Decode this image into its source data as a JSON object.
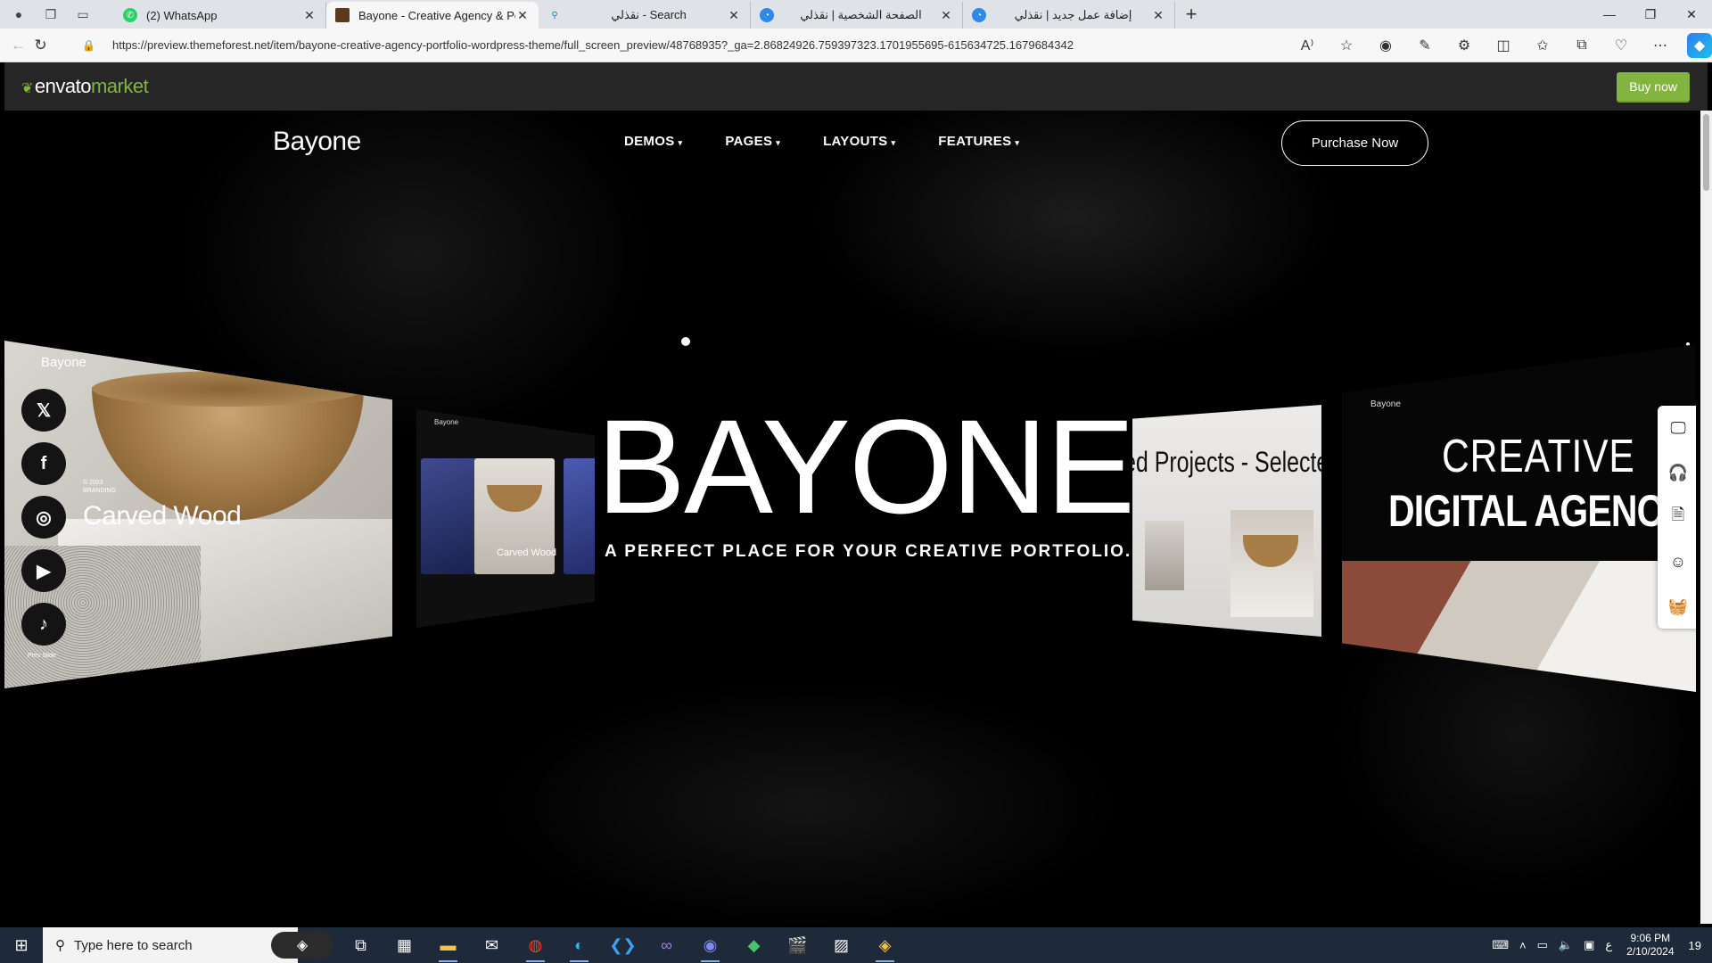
{
  "browser": {
    "tabs": [
      {
        "title": "(2) WhatsApp",
        "favicon": "whatsapp-icon",
        "rtl": false,
        "active": false
      },
      {
        "title": "Bayone - Creative Agency & Port",
        "favicon": "bayone-icon",
        "rtl": false,
        "active": true
      },
      {
        "title": "Search - نقذلي",
        "favicon": "search-icon",
        "rtl": true,
        "active": false
      },
      {
        "title": "الصفحة الشخصية | نقذلي",
        "favicon": "naqzly-icon",
        "rtl": true,
        "active": false
      },
      {
        "title": "إضافة عمل جديد | نقذلي",
        "favicon": "naqzly-icon",
        "rtl": true,
        "active": false
      }
    ],
    "url": "https://preview.themeforest.net/item/bayone-creative-agency-portfolio-wordpress-theme/full_screen_preview/48768935?_ga=2.86824926.759397323.1701955695-615634725.1679684342"
  },
  "envato": {
    "logo_word": "envato",
    "logo_market": "market",
    "buy_now": "Buy now",
    "brand_color": "#82b440"
  },
  "site": {
    "brand": "Bayone",
    "menu": [
      "DEMOS",
      "PAGES",
      "LAYOUTS",
      "FEATURES"
    ],
    "purchase": "Purchase Now",
    "hero_title": "BAYONE",
    "hero_subtitle": "A PERFECT PLACE FOR YOUR CREATIVE PORTFOLIO.",
    "slides": {
      "left_watermark": "Bayone",
      "left_caption": "Carved Wood",
      "left_meta": "© 2023\nBRANDING",
      "left_prev": "Prev Slide",
      "mid_label": "Bayone",
      "mid_caption": "Carved Wood",
      "right1_text": "ed Projects  -  Selecte",
      "right2_watermark": "Bayone",
      "right2_line1": "CREATIVE",
      "right2_line2": "DIGITAL AGENCY"
    },
    "social": [
      "x-icon",
      "facebook-icon",
      "instagram-icon",
      "youtube-icon",
      "tiktok-icon"
    ],
    "sidetools": [
      "monitor-icon",
      "headphones-icon",
      "document-icon",
      "smiley-icon",
      "basket-icon"
    ]
  },
  "taskbar": {
    "search_placeholder": "Type here to search",
    "time": "9:06 PM",
    "date": "2/10/2024",
    "lang": "ع",
    "notifications": "19"
  }
}
